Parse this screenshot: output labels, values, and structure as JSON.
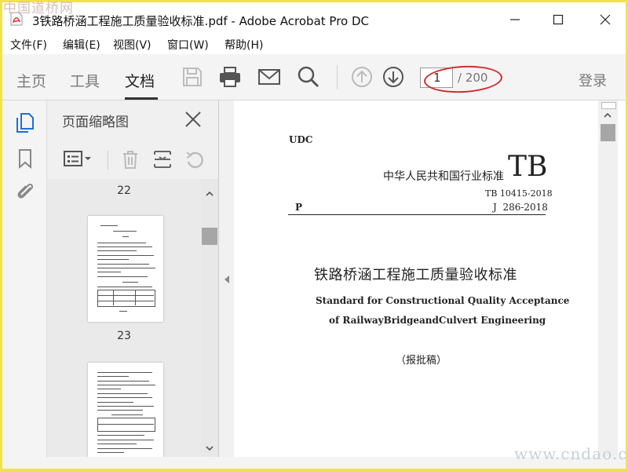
{
  "window": {
    "title": "3铁路桥涵工程施工质量验收标准.pdf - Adobe Acrobat Pro DC",
    "watermark_top": "中国道桥网",
    "watermark_bottom": "www.cndao.com"
  },
  "menu": [
    "文件(F)",
    "编辑(E)",
    "视图(V)",
    "窗口(W)",
    "帮助(H)"
  ],
  "toolbar": {
    "tabs": [
      "主页",
      "工具",
      "文档"
    ],
    "active_tab": "文档",
    "current_page": "1",
    "page_total": "/ 200",
    "login_label": "登录"
  },
  "sidebar_panel": {
    "title": "页面缩略图",
    "thumbnails": [
      {
        "label": "22"
      },
      {
        "label": "23"
      }
    ]
  },
  "document": {
    "udc": "UDC",
    "org": "中华人民共和国行业标准",
    "tb_mark": "TB",
    "std_no": "TB 10415-2018",
    "p_mark": "P",
    "j_no": "J  286-2018",
    "title_cn": "铁路桥涵工程施工质量验收标准",
    "title_en_1": "Standard for Constructional Quality Acceptance",
    "title_en_2": "of RailwayBridgeandCulvert Engineering",
    "draft": "（报批稿）"
  },
  "colors": {
    "frame": "#f2e34a",
    "highlight_ellipse": "#d12b2b",
    "toolbar_bg": "#f4f4f4"
  }
}
